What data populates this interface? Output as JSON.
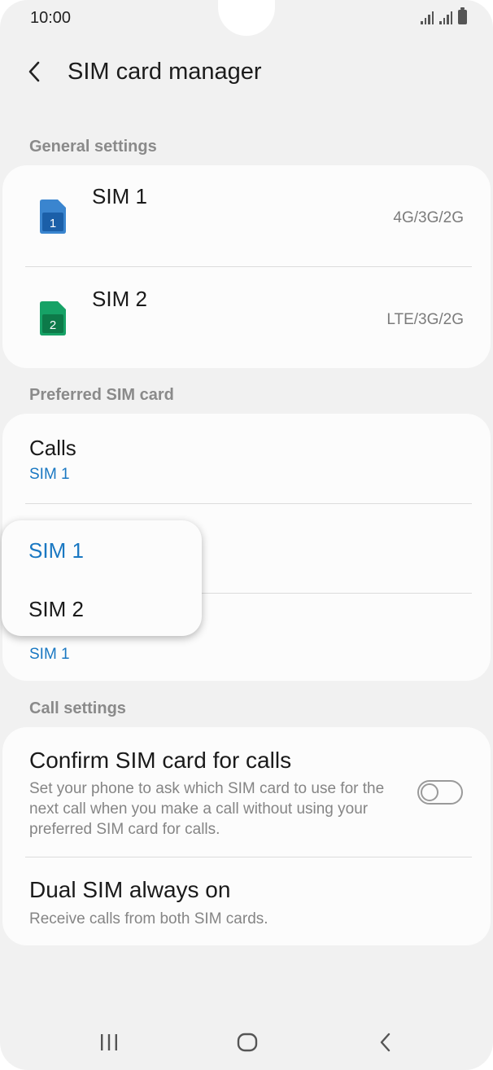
{
  "status_bar": {
    "time": "10:00"
  },
  "header": {
    "title": "SIM card manager"
  },
  "general_settings": {
    "label": "General settings",
    "sims": [
      {
        "name": "SIM 1",
        "network": "4G/3G/2G",
        "icon_number": "1",
        "color": "#3a85cf"
      },
      {
        "name": "SIM 2",
        "network": "LTE/3G/2G",
        "icon_number": "2",
        "color": "#16a266"
      }
    ]
  },
  "preferred_sim": {
    "label": "Preferred SIM card",
    "calls": {
      "title": "Calls",
      "value": "SIM 1"
    },
    "third_row_value": "SIM 1"
  },
  "popup": {
    "options": [
      {
        "label": "SIM 1",
        "selected": true
      },
      {
        "label": "SIM 2",
        "selected": false
      }
    ]
  },
  "call_settings": {
    "label": "Call settings",
    "confirm": {
      "title": "Confirm SIM card for calls",
      "description": "Set your phone to ask which SIM card to use for the next call when you make a call without using your preferred SIM card for calls.",
      "toggle_on": false
    },
    "dual": {
      "title": "Dual SIM always on",
      "description": "Receive calls from both SIM cards."
    }
  },
  "colors": {
    "accent": "#1a78c2",
    "background": "#f1f1f1",
    "card": "#fcfcfc"
  },
  "nav_bar": {
    "icons": [
      "recent-apps-icon",
      "home-icon",
      "back-icon"
    ]
  }
}
